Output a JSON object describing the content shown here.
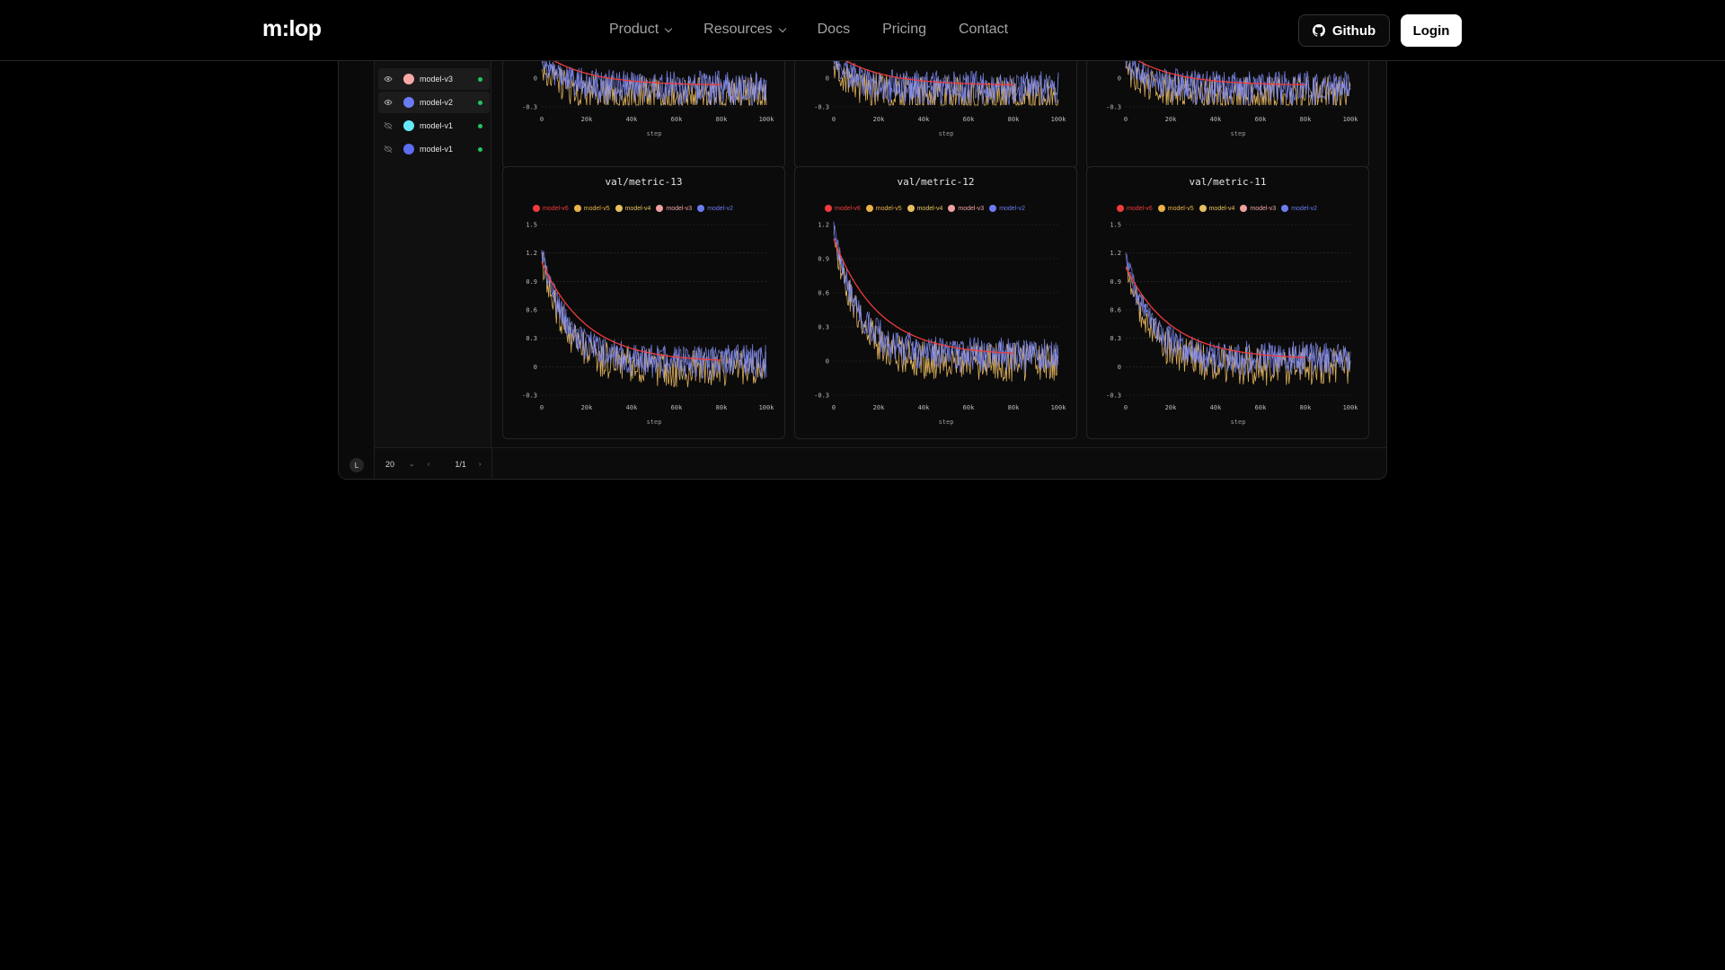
{
  "nav": {
    "logo": "m:lop",
    "links": [
      {
        "label": "Product",
        "dropdown": true
      },
      {
        "label": "Resources",
        "dropdown": true
      },
      {
        "label": "Docs",
        "dropdown": false
      },
      {
        "label": "Pricing",
        "dropdown": false
      },
      {
        "label": "Contact",
        "dropdown": false
      }
    ],
    "github_label": "Github",
    "login_label": "Login"
  },
  "runs": [
    {
      "name": "model-v3",
      "color": "#f9a8a8",
      "visible": true,
      "selected": true
    },
    {
      "name": "model-v2",
      "color": "#6a7cf5",
      "visible": true,
      "selected": true
    },
    {
      "name": "model-v1",
      "color": "#67e8f9",
      "visible": false,
      "selected": false
    },
    {
      "name": "model-v1",
      "color": "#5b6ef0",
      "visible": false,
      "selected": false
    }
  ],
  "footer": {
    "page_size": "20",
    "page": "1/1"
  },
  "sidebar_toggle": "L",
  "colors": {
    "model-v6": "#ef3b3b",
    "model-v5": "#eab24a",
    "model-v4": "#e8c060",
    "model-v3": "#f0a0a0",
    "model-v2": "#6b7cf0"
  },
  "chart_data": [
    {
      "type": "line",
      "title": "",
      "xlabel": "step",
      "x_ticks": [
        "0",
        "20k",
        "40k",
        "60k",
        "80k",
        "100k"
      ],
      "y_ticks": [
        "0",
        "-0.3"
      ],
      "ylim": [
        -0.3,
        0.1
      ],
      "partial": true,
      "series": []
    },
    {
      "type": "line",
      "title": "",
      "xlabel": "step",
      "x_ticks": [
        "0",
        "20k",
        "40k",
        "60k",
        "80k",
        "100k"
      ],
      "y_ticks": [
        "0",
        "-0.3"
      ],
      "ylim": [
        -0.3,
        0.1
      ],
      "partial": true,
      "series": []
    },
    {
      "type": "line",
      "title": "",
      "xlabel": "step",
      "x_ticks": [
        "0",
        "20k",
        "40k",
        "60k",
        "80k",
        "100k"
      ],
      "y_ticks": [
        "0",
        "-0.3"
      ],
      "ylim": [
        -0.3,
        0.1
      ],
      "partial": true,
      "series": []
    },
    {
      "type": "line",
      "title": "val/metric-13",
      "xlabel": "step",
      "x_ticks": [
        "0",
        "20k",
        "40k",
        "60k",
        "80k",
        "100k"
      ],
      "y_ticks": [
        "1.5",
        "1.2",
        "0.9",
        "0.6",
        "0.3",
        "0",
        "-0.3"
      ],
      "ylim": [
        -0.3,
        1.5
      ],
      "y_start": 1.2,
      "y_end": 0.05,
      "y_trend_end": 0.05,
      "series": [
        {
          "name": "model-v6"
        },
        {
          "name": "model-v5"
        },
        {
          "name": "model-v4"
        },
        {
          "name": "model-v3"
        },
        {
          "name": "model-v2"
        }
      ]
    },
    {
      "type": "line",
      "title": "val/metric-12",
      "xlabel": "step",
      "x_ticks": [
        "0",
        "20k",
        "40k",
        "60k",
        "80k",
        "100k"
      ],
      "y_ticks": [
        "1.2",
        "0.9",
        "0.6",
        "0.3",
        "0",
        "-0.3"
      ],
      "ylim": [
        -0.3,
        1.2
      ],
      "y_start": 1.15,
      "y_end": 0.05,
      "y_trend_end": 0.05,
      "series": [
        {
          "name": "model-v6"
        },
        {
          "name": "model-v5"
        },
        {
          "name": "model-v4"
        },
        {
          "name": "model-v3"
        },
        {
          "name": "model-v2"
        }
      ]
    },
    {
      "type": "line",
      "title": "val/metric-11",
      "xlabel": "step",
      "x_ticks": [
        "0",
        "20k",
        "40k",
        "60k",
        "80k",
        "100k"
      ],
      "y_ticks": [
        "1.5",
        "1.2",
        "0.9",
        "0.6",
        "0.3",
        "0",
        "-0.3"
      ],
      "ylim": [
        -0.3,
        1.5
      ],
      "y_start": 1.15,
      "y_end": 0.08,
      "y_trend_end": 0.08,
      "series": [
        {
          "name": "model-v6"
        },
        {
          "name": "model-v5"
        },
        {
          "name": "model-v4"
        },
        {
          "name": "model-v3"
        },
        {
          "name": "model-v2"
        }
      ]
    }
  ]
}
